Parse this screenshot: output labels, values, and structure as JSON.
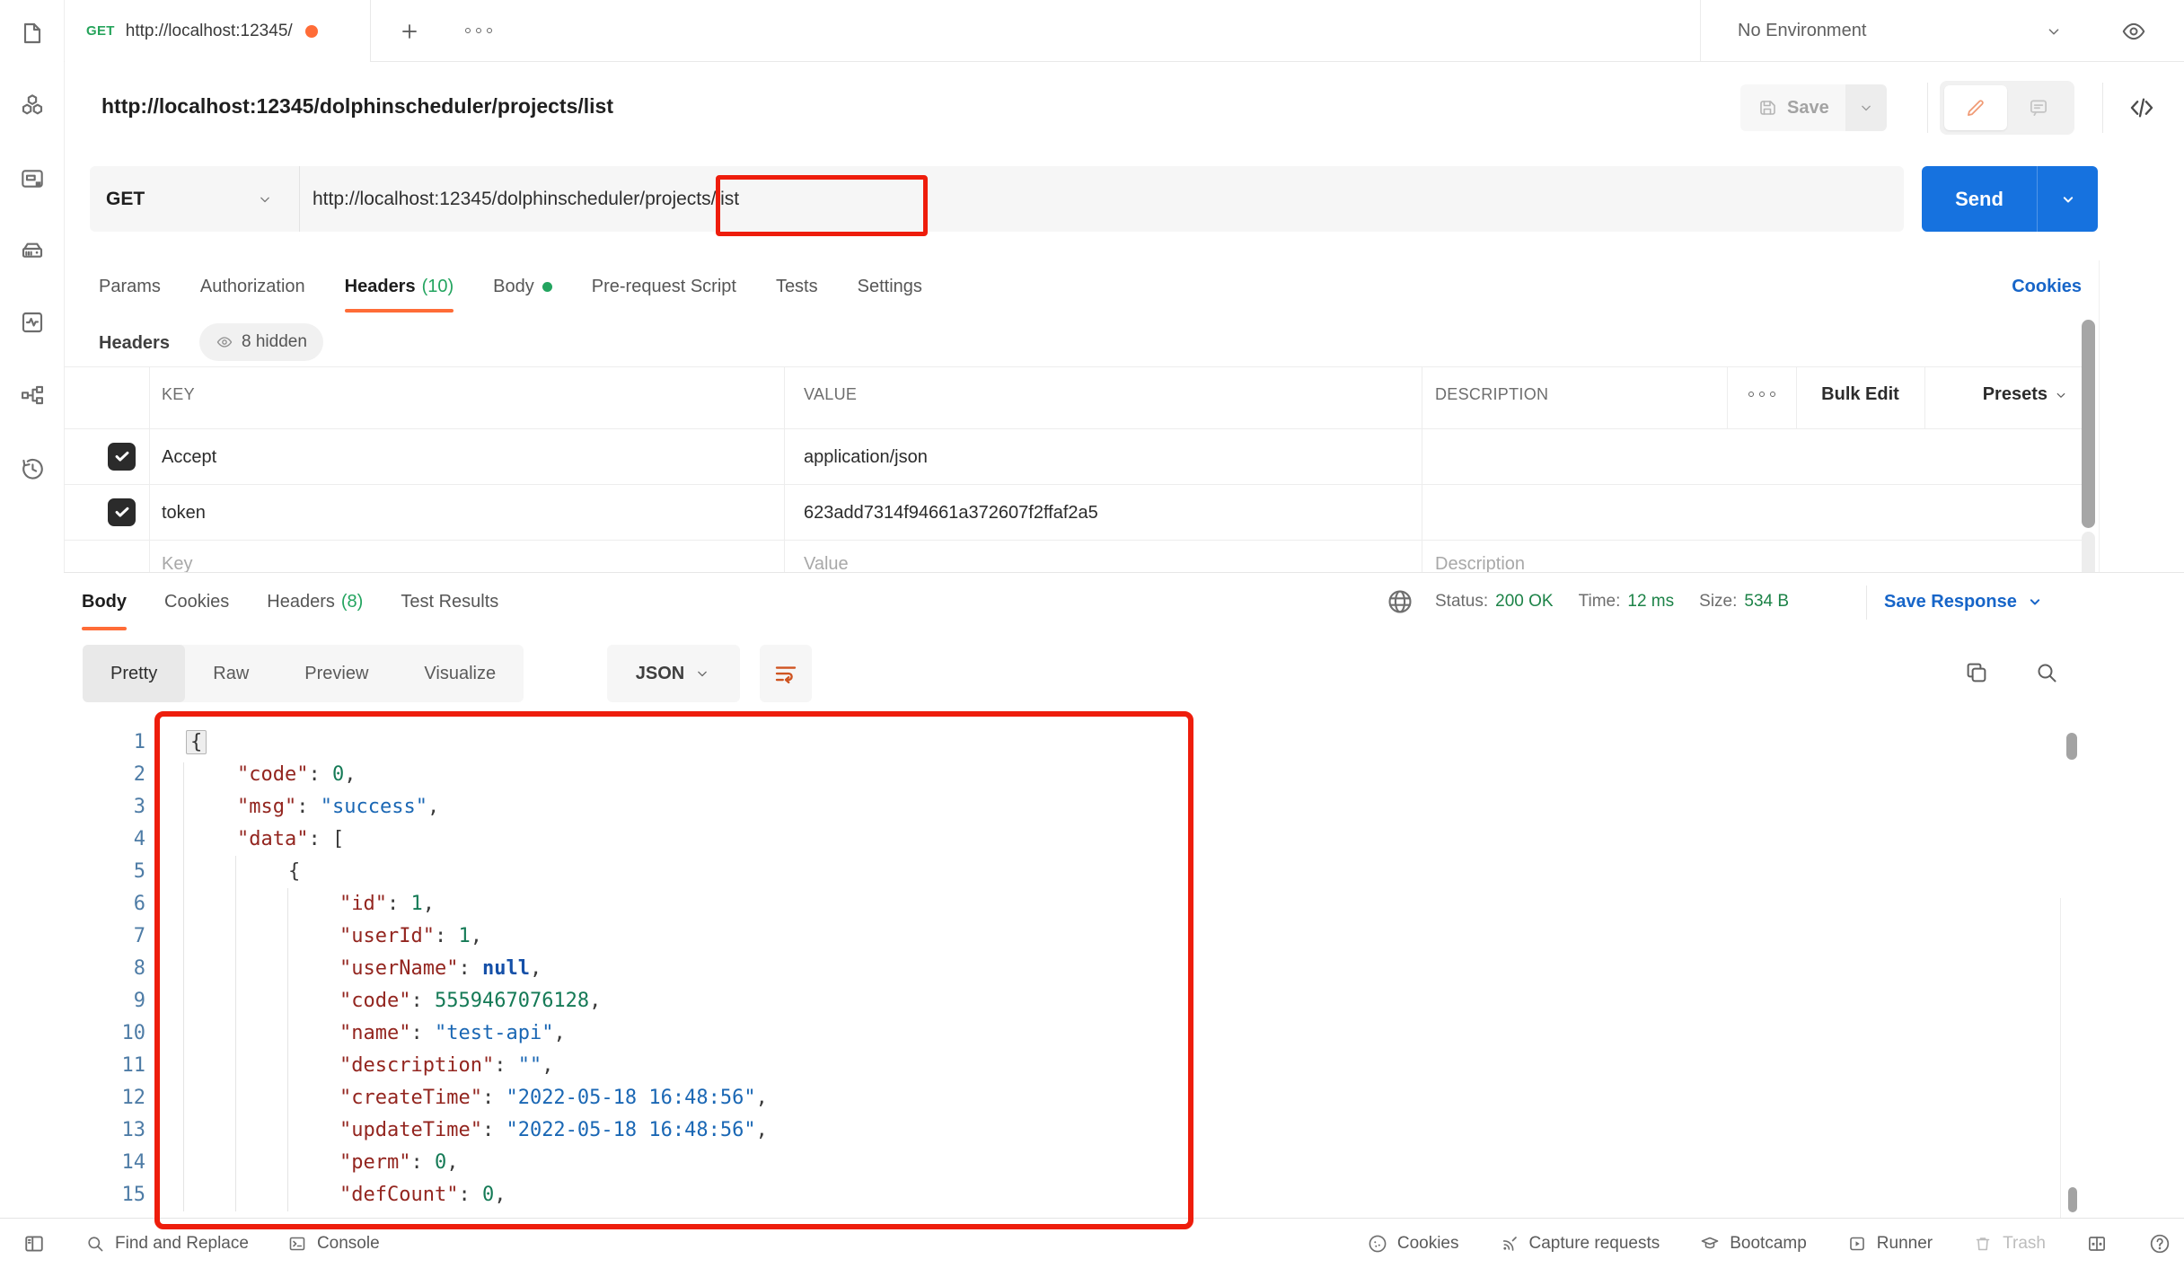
{
  "colors": {
    "accent_orange": "#ff6c37",
    "send_blue": "#1672df",
    "link_blue": "#1765c8",
    "count_green": "#23a45f",
    "status_green": "#1d8348",
    "annotation_red": "#ee1d0c"
  },
  "sidebar": {
    "icons": [
      "collections",
      "apis",
      "environments",
      "mock-servers",
      "monitors",
      "flows",
      "history"
    ]
  },
  "tabbar": {
    "tab": {
      "method": "GET",
      "title": "http://localhost:12345/"
    },
    "environment_label": "No Environment"
  },
  "request": {
    "title": "http://localhost:12345/dolphinscheduler/projects/list",
    "save_label": "Save",
    "method": "GET",
    "url": "http://localhost:12345/dolphinscheduler/projects/list",
    "send_label": "Send",
    "cookies_link": "Cookies",
    "tabs": [
      {
        "label": "Params"
      },
      {
        "label": "Authorization"
      },
      {
        "label": "Headers",
        "count": "(10)"
      },
      {
        "label": "Body"
      },
      {
        "label": "Pre-request Script"
      },
      {
        "label": "Tests"
      },
      {
        "label": "Settings"
      }
    ],
    "headers_label": "Headers",
    "hidden_badge": "8 hidden"
  },
  "headers_table": {
    "columns": [
      "KEY",
      "VALUE",
      "DESCRIPTION"
    ],
    "bulk_edit_label": "Bulk Edit",
    "presets_label": "Presets",
    "rows": [
      {
        "checked": true,
        "key": "Accept",
        "value": "application/json",
        "description": ""
      },
      {
        "checked": true,
        "key": "token",
        "value": "623add7314f94661a372607f2ffaf2a5",
        "description": ""
      },
      {
        "checked": false,
        "placeholder": true,
        "key": "Key",
        "value": "Value",
        "description": "Description"
      }
    ]
  },
  "response": {
    "tabs": [
      {
        "label": "Body"
      },
      {
        "label": "Cookies"
      },
      {
        "label": "Headers",
        "count": "(8)"
      },
      {
        "label": "Test Results"
      }
    ],
    "status_label": "Status:",
    "status_value": "200 OK",
    "time_label": "Time:",
    "time_value": "12 ms",
    "size_label": "Size:",
    "size_value": "534 B",
    "save_response_label": "Save Response",
    "view_tabs": [
      "Pretty",
      "Raw",
      "Preview",
      "Visualize"
    ],
    "format_selected": "JSON"
  },
  "code": {
    "lines": [
      {
        "n": "1",
        "indent": 0,
        "tokens": [
          [
            "h",
            "{"
          ]
        ]
      },
      {
        "n": "2",
        "indent": 1,
        "tokens": [
          [
            "k",
            "\"code\""
          ],
          [
            "p",
            ": "
          ],
          [
            "n",
            "0"
          ],
          [
            "p",
            ","
          ]
        ]
      },
      {
        "n": "3",
        "indent": 1,
        "tokens": [
          [
            "k",
            "\"msg\""
          ],
          [
            "p",
            ": "
          ],
          [
            "s",
            "\"success\""
          ],
          [
            "p",
            ","
          ]
        ]
      },
      {
        "n": "4",
        "indent": 1,
        "tokens": [
          [
            "k",
            "\"data\""
          ],
          [
            "p",
            ": ["
          ]
        ]
      },
      {
        "n": "5",
        "indent": 2,
        "tokens": [
          [
            "p",
            "{"
          ]
        ]
      },
      {
        "n": "6",
        "indent": 3,
        "tokens": [
          [
            "k",
            "\"id\""
          ],
          [
            "p",
            ": "
          ],
          [
            "n",
            "1"
          ],
          [
            "p",
            ","
          ]
        ]
      },
      {
        "n": "7",
        "indent": 3,
        "tokens": [
          [
            "k",
            "\"userId\""
          ],
          [
            "p",
            ": "
          ],
          [
            "n",
            "1"
          ],
          [
            "p",
            ","
          ]
        ]
      },
      {
        "n": "8",
        "indent": 3,
        "tokens": [
          [
            "k",
            "\"userName\""
          ],
          [
            "p",
            ": "
          ],
          [
            "l",
            "null"
          ],
          [
            "p",
            ","
          ]
        ]
      },
      {
        "n": "9",
        "indent": 3,
        "tokens": [
          [
            "k",
            "\"code\""
          ],
          [
            "p",
            ": "
          ],
          [
            "n",
            "5559467076128"
          ],
          [
            "p",
            ","
          ]
        ]
      },
      {
        "n": "10",
        "indent": 3,
        "tokens": [
          [
            "k",
            "\"name\""
          ],
          [
            "p",
            ": "
          ],
          [
            "s",
            "\"test-api\""
          ],
          [
            "p",
            ","
          ]
        ]
      },
      {
        "n": "11",
        "indent": 3,
        "tokens": [
          [
            "k",
            "\"description\""
          ],
          [
            "p",
            ": "
          ],
          [
            "s",
            "\"\""
          ],
          [
            "p",
            ","
          ]
        ]
      },
      {
        "n": "12",
        "indent": 3,
        "tokens": [
          [
            "k",
            "\"createTime\""
          ],
          [
            "p",
            ": "
          ],
          [
            "s",
            "\"2022-05-18 16:48:56\""
          ],
          [
            "p",
            ","
          ]
        ]
      },
      {
        "n": "13",
        "indent": 3,
        "tokens": [
          [
            "k",
            "\"updateTime\""
          ],
          [
            "p",
            ": "
          ],
          [
            "s",
            "\"2022-05-18 16:48:56\""
          ],
          [
            "p",
            ","
          ]
        ]
      },
      {
        "n": "14",
        "indent": 3,
        "tokens": [
          [
            "k",
            "\"perm\""
          ],
          [
            "p",
            ": "
          ],
          [
            "n",
            "0"
          ],
          [
            "p",
            ","
          ]
        ]
      },
      {
        "n": "15",
        "indent": 3,
        "tokens": [
          [
            "k",
            "\"defCount\""
          ],
          [
            "p",
            ": "
          ],
          [
            "n",
            "0"
          ],
          [
            "p",
            ","
          ]
        ]
      }
    ]
  },
  "statusbar": {
    "left": [
      {
        "label": "Find and Replace"
      },
      {
        "label": "Console"
      }
    ],
    "right": [
      {
        "label": "Cookies"
      },
      {
        "label": "Capture requests"
      },
      {
        "label": "Bootcamp"
      },
      {
        "label": "Runner"
      },
      {
        "label": "Trash"
      }
    ]
  }
}
